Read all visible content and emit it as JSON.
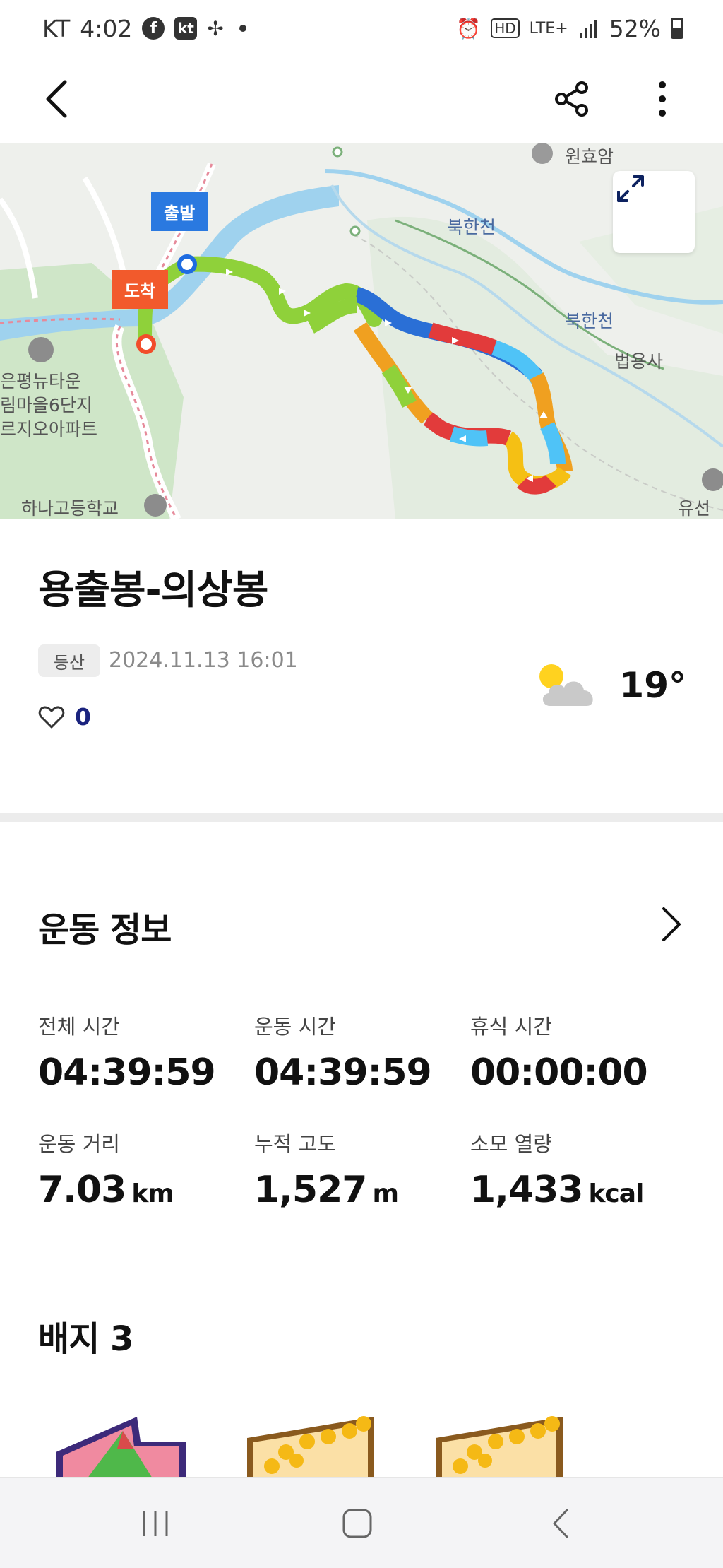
{
  "status_bar": {
    "carrier": "KT",
    "time": "4:02",
    "icons": [
      "facebook-icon",
      "kt-icon",
      "pinwheel-icon",
      "dot-icon",
      "alarm-icon",
      "hd-icon",
      "lte-icon",
      "signal-icon"
    ],
    "hd": "HD",
    "lte": "LTE+",
    "battery": "52%"
  },
  "map": {
    "start_tag": "출발",
    "end_tag": "도착",
    "labels": {
      "temple": "원효암",
      "stream1": "북한천",
      "stream2": "북한천",
      "temple2": "법용사",
      "apartment_line1": "은평뉴타운",
      "apartment_line2": "림마을6단지",
      "apartment_line3": "르지오아파트",
      "school": "하나고등학교",
      "site": "유선"
    }
  },
  "activity": {
    "title": "용출봉-의상봉",
    "category": "등산",
    "datetime": "2024.11.13 16:01",
    "likes": "0",
    "temperature": "19°"
  },
  "exercise_info": {
    "heading": "운동 정보",
    "stats": [
      {
        "label": "전체 시간",
        "value": "04:39:59",
        "unit": ""
      },
      {
        "label": "운동 시간",
        "value": "04:39:59",
        "unit": ""
      },
      {
        "label": "휴식 시간",
        "value": "00:00:00",
        "unit": ""
      },
      {
        "label": "운동 거리",
        "value": "7.03",
        "unit": "km"
      },
      {
        "label": "누적 고도",
        "value": "1,527",
        "unit": "m"
      },
      {
        "label": "소모 열량",
        "value": "1,433",
        "unit": "kcal"
      }
    ]
  },
  "badges": {
    "heading": "배지 3"
  }
}
